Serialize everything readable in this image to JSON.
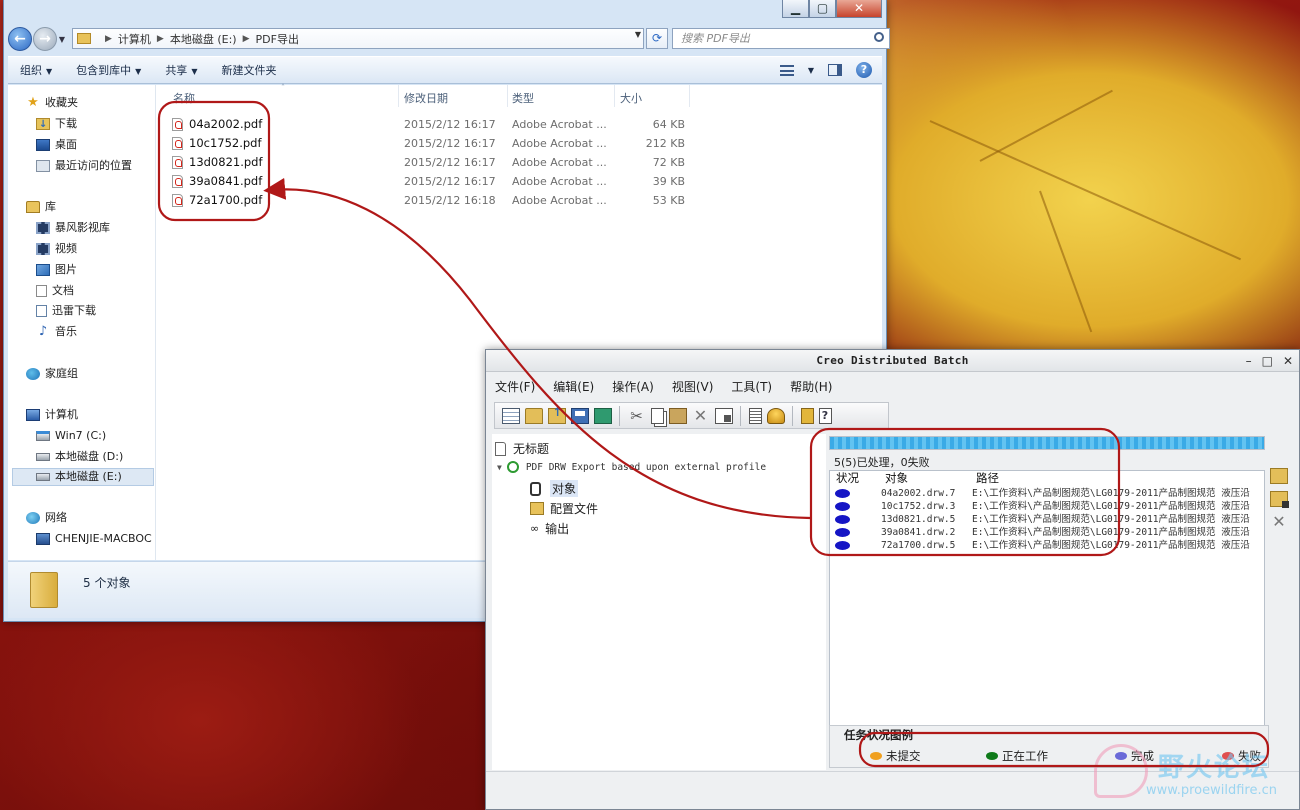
{
  "explorer": {
    "address": [
      "计算机",
      "本地磁盘 (E:)",
      "PDF导出"
    ],
    "search_placeholder": "搜索 PDF导出",
    "toolbar": {
      "organize": "组织",
      "include_in_library": "包含到库中",
      "share": "共享",
      "new_folder": "新建文件夹"
    },
    "nav": {
      "favorites": "收藏夹",
      "downloads": "下载",
      "desktop": "桌面",
      "recent": "最近访问的位置",
      "libraries": "库",
      "baofeng": "暴风影视库",
      "videos": "视频",
      "pictures": "图片",
      "documents": "文档",
      "thunder": "迅雷下载",
      "music": "音乐",
      "homegroup": "家庭组",
      "computer": "计算机",
      "drive_c": "Win7 (C:)",
      "drive_d": "本地磁盘 (D:)",
      "drive_e": "本地磁盘 (E:)",
      "network": "网络",
      "pc_name": "CHENJIE-MACBOC"
    },
    "columns": {
      "name": "名称",
      "date": "修改日期",
      "type": "类型",
      "size": "大小"
    },
    "files": [
      {
        "name": "04a2002.pdf",
        "date": "2015/2/12 16:17",
        "type": "Adobe Acrobat ...",
        "size": "64 KB"
      },
      {
        "name": "10c1752.pdf",
        "date": "2015/2/12 16:17",
        "type": "Adobe Acrobat ...",
        "size": "212 KB"
      },
      {
        "name": "13d0821.pdf",
        "date": "2015/2/12 16:17",
        "type": "Adobe Acrobat ...",
        "size": "72 KB"
      },
      {
        "name": "39a0841.pdf",
        "date": "2015/2/12 16:17",
        "type": "Adobe Acrobat ...",
        "size": "39 KB"
      },
      {
        "name": "72a1700.pdf",
        "date": "2015/2/12 16:18",
        "type": "Adobe Acrobat ...",
        "size": "53 KB"
      }
    ],
    "status": "5 个对象"
  },
  "creo": {
    "title": "Creo Distributed Batch",
    "menu": [
      "文件(F)",
      "编辑(E)",
      "操作(A)",
      "视图(V)",
      "工具(T)",
      "帮助(H)"
    ],
    "tree": {
      "root": "无标题",
      "task": "PDF DRW Export based upon external profile",
      "objects": "对象",
      "config": "配置文件",
      "output": "输出"
    },
    "progress_fraction": 1.0,
    "progress_text": "5(5)已处理，0失败",
    "table_headers": {
      "status": "状况",
      "object": "对象",
      "path": "路径"
    },
    "jobs": [
      {
        "object": "04a2002.drw.7",
        "path": "E:\\工作资料\\产品制图规范\\LG0179-2011产品制图规范 液压沿"
      },
      {
        "object": "10c1752.drw.3",
        "path": "E:\\工作资料\\产品制图规范\\LG0179-2011产品制图规范 液压沿"
      },
      {
        "object": "13d0821.drw.5",
        "path": "E:\\工作资料\\产品制图规范\\LG0179-2011产品制图规范 液压沿"
      },
      {
        "object": "39a0841.drw.2",
        "path": "E:\\工作资料\\产品制图规范\\LG0179-2011产品制图规范 液压沿"
      },
      {
        "object": "72a1700.drw.5",
        "path": "E:\\工作资料\\产品制图规范\\LG0179-2011产品制图规范 液压沿"
      }
    ],
    "legend": {
      "title": "任务状况图例",
      "items": [
        {
          "label": "未提交",
          "color": "#f0a020"
        },
        {
          "label": "正在工作",
          "color": "#0e7a1a"
        },
        {
          "label": "完成",
          "color": "#6a6ad8"
        },
        {
          "label": "失败",
          "color": "#e05050"
        }
      ]
    },
    "status_dot_color": "#1515c5"
  },
  "watermark": {
    "text": "野火论坛",
    "url": "www.proewildfire.cn"
  },
  "annotation_color": "#b01818"
}
